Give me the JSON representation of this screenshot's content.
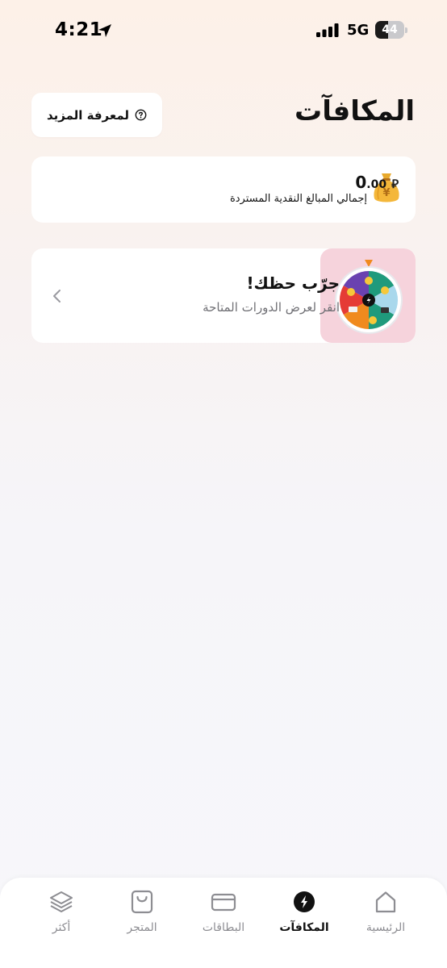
{
  "status_bar": {
    "time": "4:21",
    "network": "5G",
    "battery": "44",
    "battery_level": 0.44
  },
  "header": {
    "title": "المكافآت",
    "learn_more_label": "لمعرفة المزيد"
  },
  "cashback": {
    "amount_int": "0",
    "amount_dec": ".00",
    "currency": "⃁",
    "label": "إجمالي المبالغ النقدية المستردة"
  },
  "spin_wheel": {
    "title": "جرّب حظك!",
    "subtitle": "انقر لعرض الدورات المتاحة"
  },
  "tab_bar": {
    "items": [
      {
        "label": "الرئيسية",
        "icon": "home-icon"
      },
      {
        "label": "المكافآت",
        "icon": "rewards-icon"
      },
      {
        "label": "البطاقات",
        "icon": "card-icon"
      },
      {
        "label": "المتجر",
        "icon": "shopping-bag-icon"
      },
      {
        "label": "أكثر",
        "icon": "layers-icon"
      }
    ],
    "active_index": 1
  },
  "colors": {
    "accent": "#111111",
    "inactive": "#8d8d92",
    "wheel_bg": "#f6d3dc"
  }
}
